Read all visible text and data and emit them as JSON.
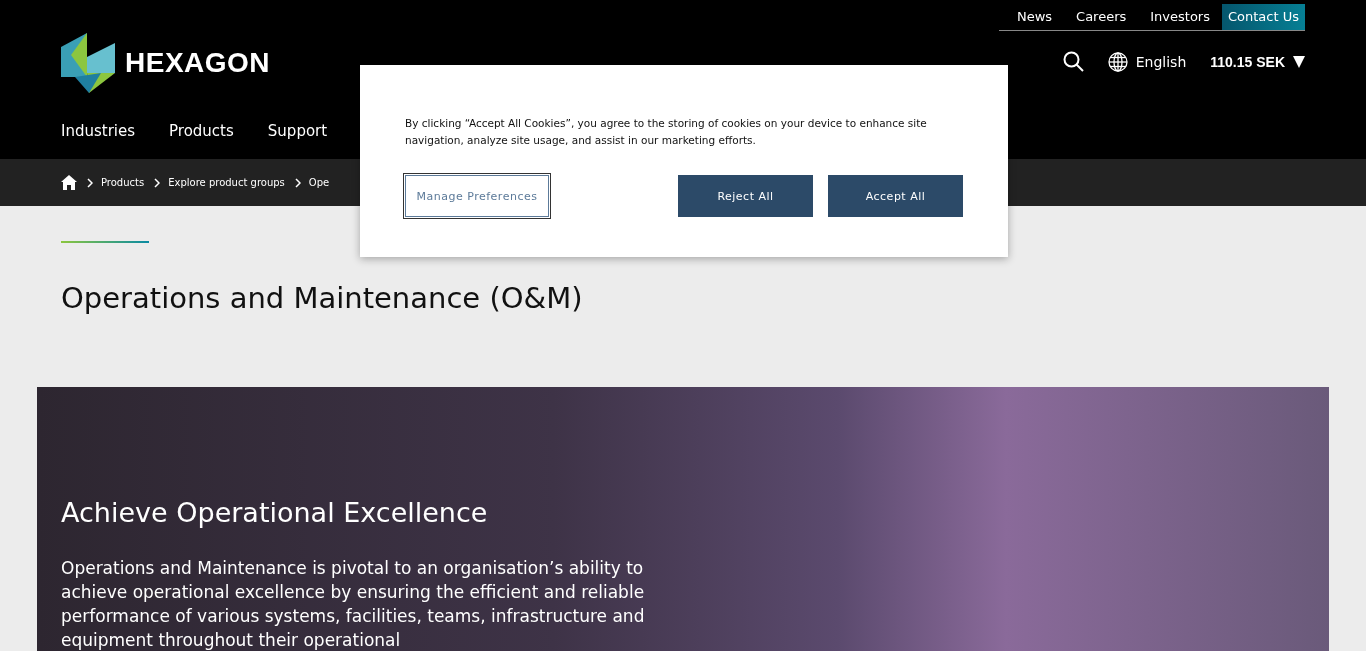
{
  "top_links": [
    {
      "label": "News",
      "selected": false
    },
    {
      "label": "Careers",
      "selected": false
    },
    {
      "label": "Investors",
      "selected": false
    },
    {
      "label": "Contact Us",
      "selected": true
    }
  ],
  "logo": {
    "text": "HEXAGON"
  },
  "language": "English",
  "stock": "110.15 SEK",
  "main_nav": [
    "Industries",
    "Products",
    "Support"
  ],
  "breadcrumb": [
    "Products",
    "Explore product groups",
    "Ope"
  ],
  "page_title": "Operations and Maintenance (O&M)",
  "hero": {
    "heading": "Achieve Operational Excellence",
    "text": "Operations and Maintenance is pivotal to an organisation’s ability to achieve operational excellence by ensuring the efficient and reliable performance of various systems, facilities, teams, infrastructure and equipment throughout their operational"
  },
  "cookie_dialog": {
    "text": "By clicking “Accept All Cookies”, you agree to the storing of cookies on your device to enhance site navigation, analyze site usage, and assist in our marketing efforts.",
    "buttons": [
      {
        "label": "Manage Preferences",
        "kind": "outline"
      },
      {
        "label": "Reject All",
        "kind": "solid"
      },
      {
        "label": "Accept All",
        "kind": "solid"
      }
    ]
  }
}
